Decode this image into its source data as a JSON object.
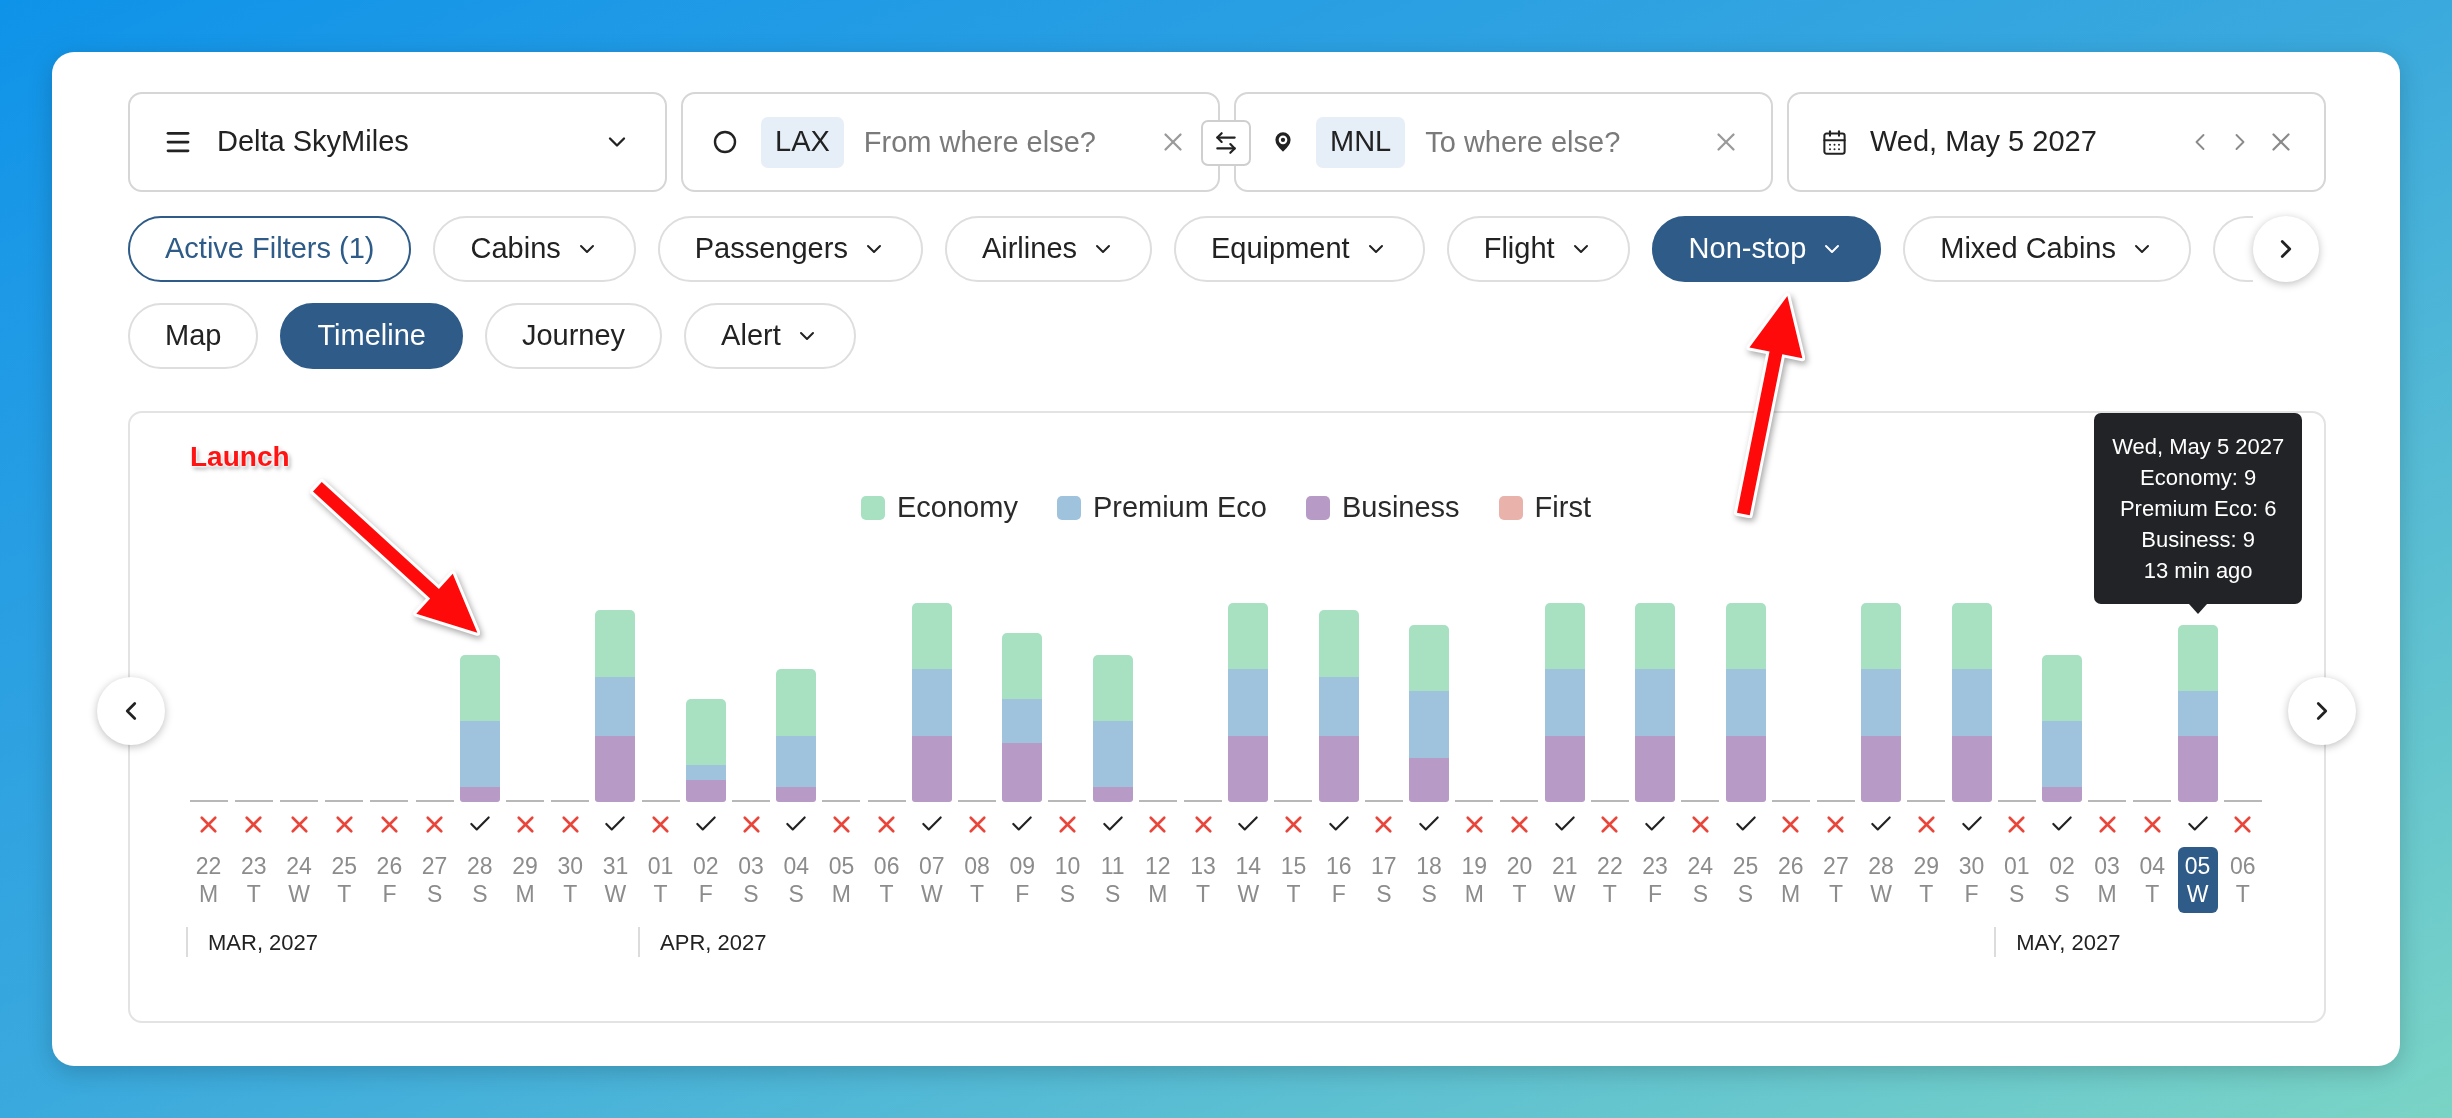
{
  "search_bar": {
    "program": {
      "label": "Delta SkyMiles"
    },
    "origin": {
      "code": "LAX",
      "placeholder": "From where else?"
    },
    "destination": {
      "code": "MNL",
      "placeholder": "To where else?"
    },
    "date": {
      "value": "Wed, May 5 2027"
    }
  },
  "filters": [
    {
      "kind": "summary",
      "label": "Active Filters (1)",
      "selected": false
    },
    {
      "kind": "dropdown",
      "label": "Cabins",
      "selected": false
    },
    {
      "kind": "dropdown",
      "label": "Passengers",
      "selected": false
    },
    {
      "kind": "dropdown",
      "label": "Airlines",
      "selected": false
    },
    {
      "kind": "dropdown",
      "label": "Equipment",
      "selected": false
    },
    {
      "kind": "dropdown",
      "label": "Flight",
      "selected": false
    },
    {
      "kind": "dropdown",
      "label": "Non-stop",
      "selected": true
    },
    {
      "kind": "dropdown",
      "label": "Mixed Cabins",
      "selected": false
    },
    {
      "kind": "clipped",
      "selected": false
    }
  ],
  "views": [
    {
      "kind": "tab",
      "label": "Map",
      "selected": false
    },
    {
      "kind": "tab",
      "label": "Timeline",
      "selected": true
    },
    {
      "kind": "tab",
      "label": "Journey",
      "selected": false
    },
    {
      "kind": "dropdown",
      "label": "Alert",
      "selected": false
    }
  ],
  "timeline": {
    "legend": [
      {
        "label": "Economy",
        "color": "#a8e0c2"
      },
      {
        "label": "Premium Eco",
        "color": "#9fc3dd"
      },
      {
        "label": "Business",
        "color": "#b79ac5"
      },
      {
        "label": "First",
        "color": "#e9b3ab"
      }
    ],
    "tooltip": {
      "lines": [
        "Wed, May 5 2027",
        "Economy: 9",
        "Premium Eco: 6",
        "Business: 9",
        "13 min ago"
      ]
    },
    "months": [
      {
        "label": "MAR, 2027",
        "days": [
          {
            "day": "22",
            "weekday": "M",
            "available": false,
            "selected": false
          },
          {
            "day": "23",
            "weekday": "T",
            "available": false,
            "selected": false
          },
          {
            "day": "24",
            "weekday": "W",
            "available": false,
            "selected": false
          },
          {
            "day": "25",
            "weekday": "T",
            "available": false,
            "selected": false
          },
          {
            "day": "26",
            "weekday": "F",
            "available": false,
            "selected": false
          },
          {
            "day": "27",
            "weekday": "S",
            "available": false,
            "selected": false
          },
          {
            "day": "28",
            "weekday": "S",
            "available": true,
            "selected": false
          },
          {
            "day": "29",
            "weekday": "M",
            "available": false,
            "selected": false
          },
          {
            "day": "30",
            "weekday": "T",
            "available": false,
            "selected": false
          },
          {
            "day": "31",
            "weekday": "W",
            "available": true,
            "selected": false
          }
        ]
      },
      {
        "label": "APR, 2027",
        "days": [
          {
            "day": "01",
            "weekday": "T",
            "available": false,
            "selected": false
          },
          {
            "day": "02",
            "weekday": "F",
            "available": true,
            "selected": false
          },
          {
            "day": "03",
            "weekday": "S",
            "available": false,
            "selected": false
          },
          {
            "day": "04",
            "weekday": "S",
            "available": true,
            "selected": false
          },
          {
            "day": "05",
            "weekday": "M",
            "available": false,
            "selected": false
          },
          {
            "day": "06",
            "weekday": "T",
            "available": false,
            "selected": false
          },
          {
            "day": "07",
            "weekday": "W",
            "available": true,
            "selected": false
          },
          {
            "day": "08",
            "weekday": "T",
            "available": false,
            "selected": false
          },
          {
            "day": "09",
            "weekday": "F",
            "available": true,
            "selected": false
          },
          {
            "day": "10",
            "weekday": "S",
            "available": false,
            "selected": false
          },
          {
            "day": "11",
            "weekday": "S",
            "available": true,
            "selected": false
          },
          {
            "day": "12",
            "weekday": "M",
            "available": false,
            "selected": false
          },
          {
            "day": "13",
            "weekday": "T",
            "available": false,
            "selected": false
          },
          {
            "day": "14",
            "weekday": "W",
            "available": true,
            "selected": false
          },
          {
            "day": "15",
            "weekday": "T",
            "available": false,
            "selected": false
          },
          {
            "day": "16",
            "weekday": "F",
            "available": true,
            "selected": false
          },
          {
            "day": "17",
            "weekday": "S",
            "available": false,
            "selected": false
          },
          {
            "day": "18",
            "weekday": "S",
            "available": true,
            "selected": false
          },
          {
            "day": "19",
            "weekday": "M",
            "available": false,
            "selected": false
          },
          {
            "day": "20",
            "weekday": "T",
            "available": false,
            "selected": false
          },
          {
            "day": "21",
            "weekday": "W",
            "available": true,
            "selected": false
          },
          {
            "day": "22",
            "weekday": "T",
            "available": false,
            "selected": false
          },
          {
            "day": "23",
            "weekday": "F",
            "available": true,
            "selected": false
          },
          {
            "day": "24",
            "weekday": "S",
            "available": false,
            "selected": false
          },
          {
            "day": "25",
            "weekday": "S",
            "available": true,
            "selected": false
          },
          {
            "day": "26",
            "weekday": "M",
            "available": false,
            "selected": false
          },
          {
            "day": "27",
            "weekday": "T",
            "available": false,
            "selected": false
          },
          {
            "day": "28",
            "weekday": "W",
            "available": true,
            "selected": false
          },
          {
            "day": "29",
            "weekday": "T",
            "available": false,
            "selected": false
          },
          {
            "day": "30",
            "weekday": "F",
            "available": true,
            "selected": false
          }
        ]
      },
      {
        "label": "MAY, 2027",
        "days": [
          {
            "day": "01",
            "weekday": "S",
            "available": false,
            "selected": false
          },
          {
            "day": "02",
            "weekday": "S",
            "available": true,
            "selected": false
          },
          {
            "day": "03",
            "weekday": "M",
            "available": false,
            "selected": false
          },
          {
            "day": "04",
            "weekday": "T",
            "available": false,
            "selected": false
          },
          {
            "day": "05",
            "weekday": "W",
            "available": true,
            "selected": true
          },
          {
            "day": "06",
            "weekday": "T",
            "available": false,
            "selected": false
          }
        ]
      }
    ]
  },
  "annotation": {
    "text": "Launch"
  }
}
